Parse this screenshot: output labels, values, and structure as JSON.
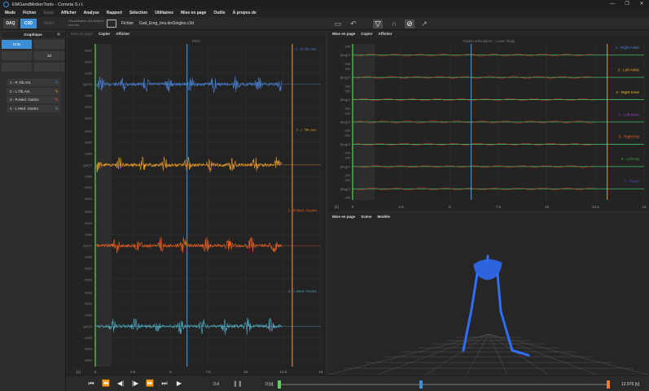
{
  "window": {
    "title": "EMGandMotionTools - Cometa S.r.l.",
    "controls": [
      "—",
      "❐",
      "✕"
    ]
  },
  "menu": {
    "items": [
      {
        "label": "Mode",
        "enabled": true
      },
      {
        "label": "Fichier",
        "enabled": true
      },
      {
        "label": "Essai",
        "enabled": false
      },
      {
        "label": "Afficher",
        "enabled": true
      },
      {
        "label": "Analyse",
        "enabled": true
      },
      {
        "label": "Rapport",
        "enabled": true
      },
      {
        "label": "Sélection",
        "enabled": true
      },
      {
        "label": "Utilitaires",
        "enabled": true
      },
      {
        "label": "Mise en page",
        "enabled": true
      },
      {
        "label": "Outils",
        "enabled": true
      },
      {
        "label": "À propos de",
        "enabled": true
      }
    ]
  },
  "toolbar": {
    "tab_daq": "DAQ",
    "tab_c3d": "C3D",
    "tab_motion": "Motio",
    "visualisation_note": "Visualisation des fichiers récents",
    "fichier_label": "Fichier",
    "file_name": "Gait_Emg_Imu.kinSingles.c3d"
  },
  "sidebar": {
    "header": "Graphique",
    "collapse": "«",
    "cells": [
      {
        "label": "Grilo",
        "selected": true
      },
      {
        "label": "",
        "selected": false
      },
      {
        "label": "",
        "selected": false
      },
      {
        "label": "3d",
        "selected": false
      },
      {
        "label": "",
        "selected": false
      },
      {
        "label": "",
        "selected": false
      }
    ],
    "channels": [
      {
        "label": "1 - R.Tib.Ant.",
        "color": "#3c8fd6"
      },
      {
        "label": "2 - L.Tib.Ant.",
        "color": "#f0a02a"
      },
      {
        "label": "3 - R.Med. Gastro",
        "color": "#f06020"
      },
      {
        "label": "4 - L.Med. Gastro",
        "color": "#4fb0c6"
      }
    ]
  },
  "emg_panel": {
    "head": {
      "mise_en_page": "Mise en page",
      "copier": "Copier",
      "afficher": "Afficher"
    },
    "title": "EMG",
    "ylabel": "[µV]",
    "xlabel": "[s]",
    "xticks": [
      "0",
      "2.5",
      "5",
      "7.5",
      "10",
      "12.5",
      "15"
    ],
    "tracks": [
      {
        "label": "1 - R.Tib.Ant.",
        "color": "#4a82d6",
        "ticks": [
          "3000",
          "2000",
          "1000",
          "[µV] 0",
          "-1000",
          "-2000",
          "-3000"
        ]
      },
      {
        "label": "2 - L.Tib.Ant.",
        "color": "#f0a02a",
        "ticks": [
          "3000",
          "2000",
          "1000",
          "[µV] 0",
          "-1000",
          "-2000",
          "-3000"
        ]
      },
      {
        "label": "3 - R.Med. Gastro",
        "color": "#f06020",
        "ticks": [
          "3000",
          "2000",
          "1000",
          "[µV] 0",
          "-1000",
          "-2000",
          "-3000"
        ]
      },
      {
        "label": "4 - L.Med. Gastro",
        "color": "#4fb0c6",
        "ticks": [
          "3000",
          "2000",
          "1000",
          "[µV] 0",
          "-1000",
          "-2000",
          "-3000"
        ]
      }
    ]
  },
  "angle_panel": {
    "head": {
      "mise_en_page": "Mise en page",
      "copier": "Copier",
      "afficher": "Afficher"
    },
    "title": "Angles articulaires - Lower Body",
    "xlabel": "[s]",
    "xticks": [
      "0",
      "2.5",
      "5",
      "7.5",
      "10",
      "12.5",
      "15"
    ],
    "tracks": [
      {
        "label": "1 - Right Ankle",
        "color": "#4a82d6"
      },
      {
        "label": "2 - Left Ankle",
        "color": "#f0a02a"
      },
      {
        "label": "3 - Right Knee",
        "color": "#f0c020"
      },
      {
        "label": "4 - Left Knee",
        "color": "#a040c0"
      },
      {
        "label": "5 - Right Hip",
        "color": "#f06020"
      },
      {
        "label": "6 - Left Hip",
        "color": "#40a040"
      },
      {
        "label": "7 - Pelvis",
        "color": "#5050d0"
      }
    ],
    "tick_labels": [
      "-200",
      "[Deg] 0",
      "-200"
    ]
  },
  "scene_panel": {
    "head": {
      "mise_en_page": "Mise en page",
      "scene": "Scène",
      "modele": "Modèle"
    }
  },
  "playbar": {
    "buttons": [
      "⏮",
      "⏪",
      "◀|",
      "|▶",
      "⏩",
      "⏭",
      "▶"
    ],
    "speed": "0.4",
    "pause": "❚❚",
    "start_value": "0",
    "start_unit": "[s]",
    "end_value": "12.976",
    "end_unit": "[s]",
    "cursor_fraction": 0.43
  },
  "colors": {
    "accent": "#3c8fd6",
    "start_marker": "#5fd05f",
    "end_marker": "#f07a3a",
    "cursor": "#3c8fd6"
  }
}
